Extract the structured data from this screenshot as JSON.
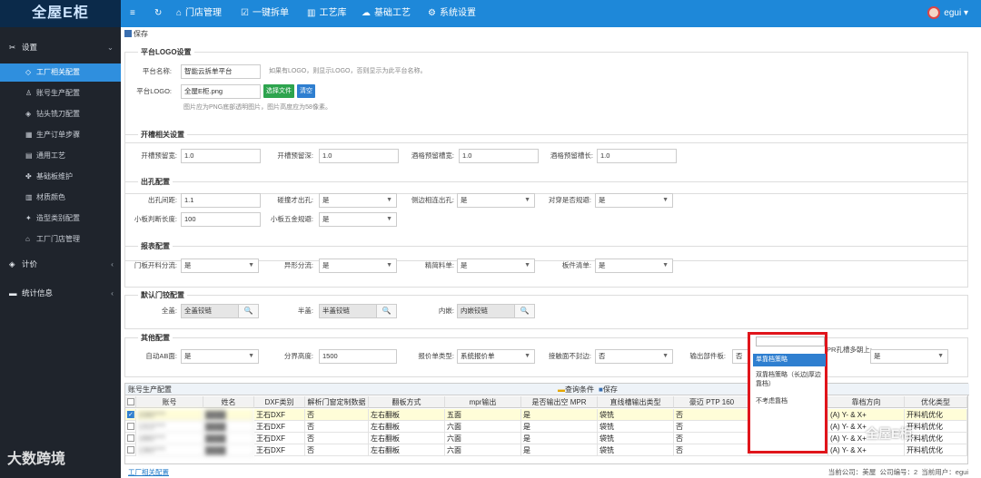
{
  "app": {
    "logo": "全屋E柜"
  },
  "topnav": {
    "menu_icon": "≡",
    "refresh_icon": "↻",
    "items": [
      {
        "icon": "⌂",
        "label": "门店管理"
      },
      {
        "icon": "☑",
        "label": "一键拆单"
      },
      {
        "icon": "▥",
        "label": "工艺库"
      },
      {
        "icon": "☁",
        "label": "基础工艺"
      },
      {
        "icon": "⚙",
        "label": "系统设置"
      }
    ],
    "user": "egui"
  },
  "sidebar": {
    "groups": [
      {
        "icon": "✂",
        "label": "设置",
        "caret": "⌄"
      },
      {
        "icon": "◈",
        "label": "计价",
        "caret": "‹"
      },
      {
        "icon": "▬",
        "label": "统计信息",
        "caret": "‹"
      }
    ],
    "items": [
      {
        "icon": "◇",
        "label": "工厂相关配置",
        "active": true
      },
      {
        "icon": "♙",
        "label": "账号生产配置"
      },
      {
        "icon": "◈",
        "label": "钻头铣刀配置"
      },
      {
        "icon": "▦",
        "label": "生产订单步骤"
      },
      {
        "icon": "▤",
        "label": "通用工艺"
      },
      {
        "icon": "✤",
        "label": "基础板维护"
      },
      {
        "icon": "▥",
        "label": "材质颜色"
      },
      {
        "icon": "✦",
        "label": "造型类别配置"
      },
      {
        "icon": "⌂",
        "label": "工厂门店管理"
      }
    ]
  },
  "toolbar": {
    "save_label": "保存"
  },
  "sections": {
    "logo": {
      "title": "平台LOGO设置",
      "name_label": "平台名称:",
      "name_value": "智能云拆单平台",
      "name_hint": "如果有LOGO，则显示LOGO，否则显示为此平台名称。",
      "logo_label": "平台LOGO:",
      "logo_value": "全屋E柜.png",
      "choose_btn": "选择文件",
      "clear_btn": "清空",
      "logo_hint": "图片应为PNG底部透明图片，图片高度应为58像素。"
    },
    "slot": {
      "title": "开槽相关设置",
      "fields": [
        {
          "label": "开槽预留宽:",
          "value": "1.0"
        },
        {
          "label": "开槽预留深:",
          "value": "1.0"
        },
        {
          "label": "酒格预留槽宽:",
          "value": "1.0"
        },
        {
          "label": "酒格预留槽长:",
          "value": "1.0"
        }
      ]
    },
    "hole": {
      "title": "出孔配置",
      "r1": [
        {
          "label": "出孔间距:",
          "value": "1.1",
          "kind": "input"
        },
        {
          "label": "碰撞才出孔:",
          "value": "是",
          "kind": "select"
        },
        {
          "label": "侧边相连出孔:",
          "value": "是",
          "kind": "select"
        },
        {
          "label": "对穿是否规避:",
          "value": "是",
          "kind": "select"
        }
      ],
      "r2": [
        {
          "label": "小板判断长度:",
          "value": "100",
          "kind": "input"
        },
        {
          "label": "小板五金规避:",
          "value": "是",
          "kind": "select"
        }
      ]
    },
    "report": {
      "title": "报表配置",
      "fields": [
        {
          "label": "门板开料分流:",
          "value": "是"
        },
        {
          "label": "异形分流:",
          "value": "是"
        },
        {
          "label": "精简料单:",
          "value": "是"
        },
        {
          "label": "板件清单:",
          "value": "是"
        }
      ]
    },
    "door": {
      "title": "默认门铰配置",
      "fields": [
        {
          "label": "全盖:",
          "value": "全盖铰链"
        },
        {
          "label": "半盖:",
          "value": "半盖铰链"
        },
        {
          "label": "内嵌:",
          "value": "内嵌铰链"
        }
      ],
      "search_icon": "🔍"
    },
    "other": {
      "title": "其他配置",
      "fields": [
        {
          "label": "自动AB面:",
          "value": "是",
          "kind": "select"
        },
        {
          "label": "分界高度:",
          "value": "1500",
          "kind": "input"
        },
        {
          "label": "报价单类型:",
          "value": "系统报价单",
          "kind": "select"
        },
        {
          "label": "接触面不封边:",
          "value": "否",
          "kind": "select"
        },
        {
          "label": "输出部件板:",
          "value": "否",
          "kind": "select"
        },
        {
          "label": "PR孔槽多朝上:",
          "value": "是",
          "kind": "select"
        }
      ]
    }
  },
  "grid": {
    "title": "账号生产配置",
    "query_label": "查询条件",
    "save_label": "保存",
    "columns": [
      "账号",
      "姓名",
      "DXF类别",
      "解析门窗定制数据",
      "翻板方式",
      "mpr输出",
      "是否输出空 MPR",
      "直线槽输出类型",
      "豪迈 PTP 160",
      "",
      "靠档方向",
      "优化类型"
    ],
    "rows": [
      [
        "1580****",
        "████",
        "王石DXF",
        "否",
        "左右翻板",
        "五面",
        "是",
        "袋铣",
        "否",
        "单靠档策略",
        "(A) Y- & X+",
        "开料机优化"
      ],
      [
        "1315****",
        "████",
        "王石DXF",
        "否",
        "左右翻板",
        "六面",
        "是",
        "袋铣",
        "否",
        "单靠档策略",
        "(A) Y- & X+",
        "开料机优化"
      ],
      [
        "1880****",
        "████",
        "王石DXF",
        "否",
        "左右翻板",
        "六面",
        "是",
        "袋铣",
        "否",
        "单靠档策略",
        "(A) Y- & X+",
        "开料机优化"
      ],
      [
        "1360****",
        "████",
        "王石DXF",
        "否",
        "左右翻板",
        "六面",
        "是",
        "袋铣",
        "否",
        "单靠档策略",
        "(A) Y- & X+",
        "开料机优化"
      ]
    ]
  },
  "dropdown": {
    "options": [
      "单靠档策略",
      "双靠档策略（长边|厚边 靠档）",
      "不考虑靠档"
    ]
  },
  "status": {
    "link": "工厂相关配置",
    "company_label": "当前公司：美屋",
    "company_id_label": "公司编号：2",
    "user_label": "当前用户：egui"
  },
  "watermarks": {
    "left": "大数跨境",
    "right": "全屋E柜"
  }
}
